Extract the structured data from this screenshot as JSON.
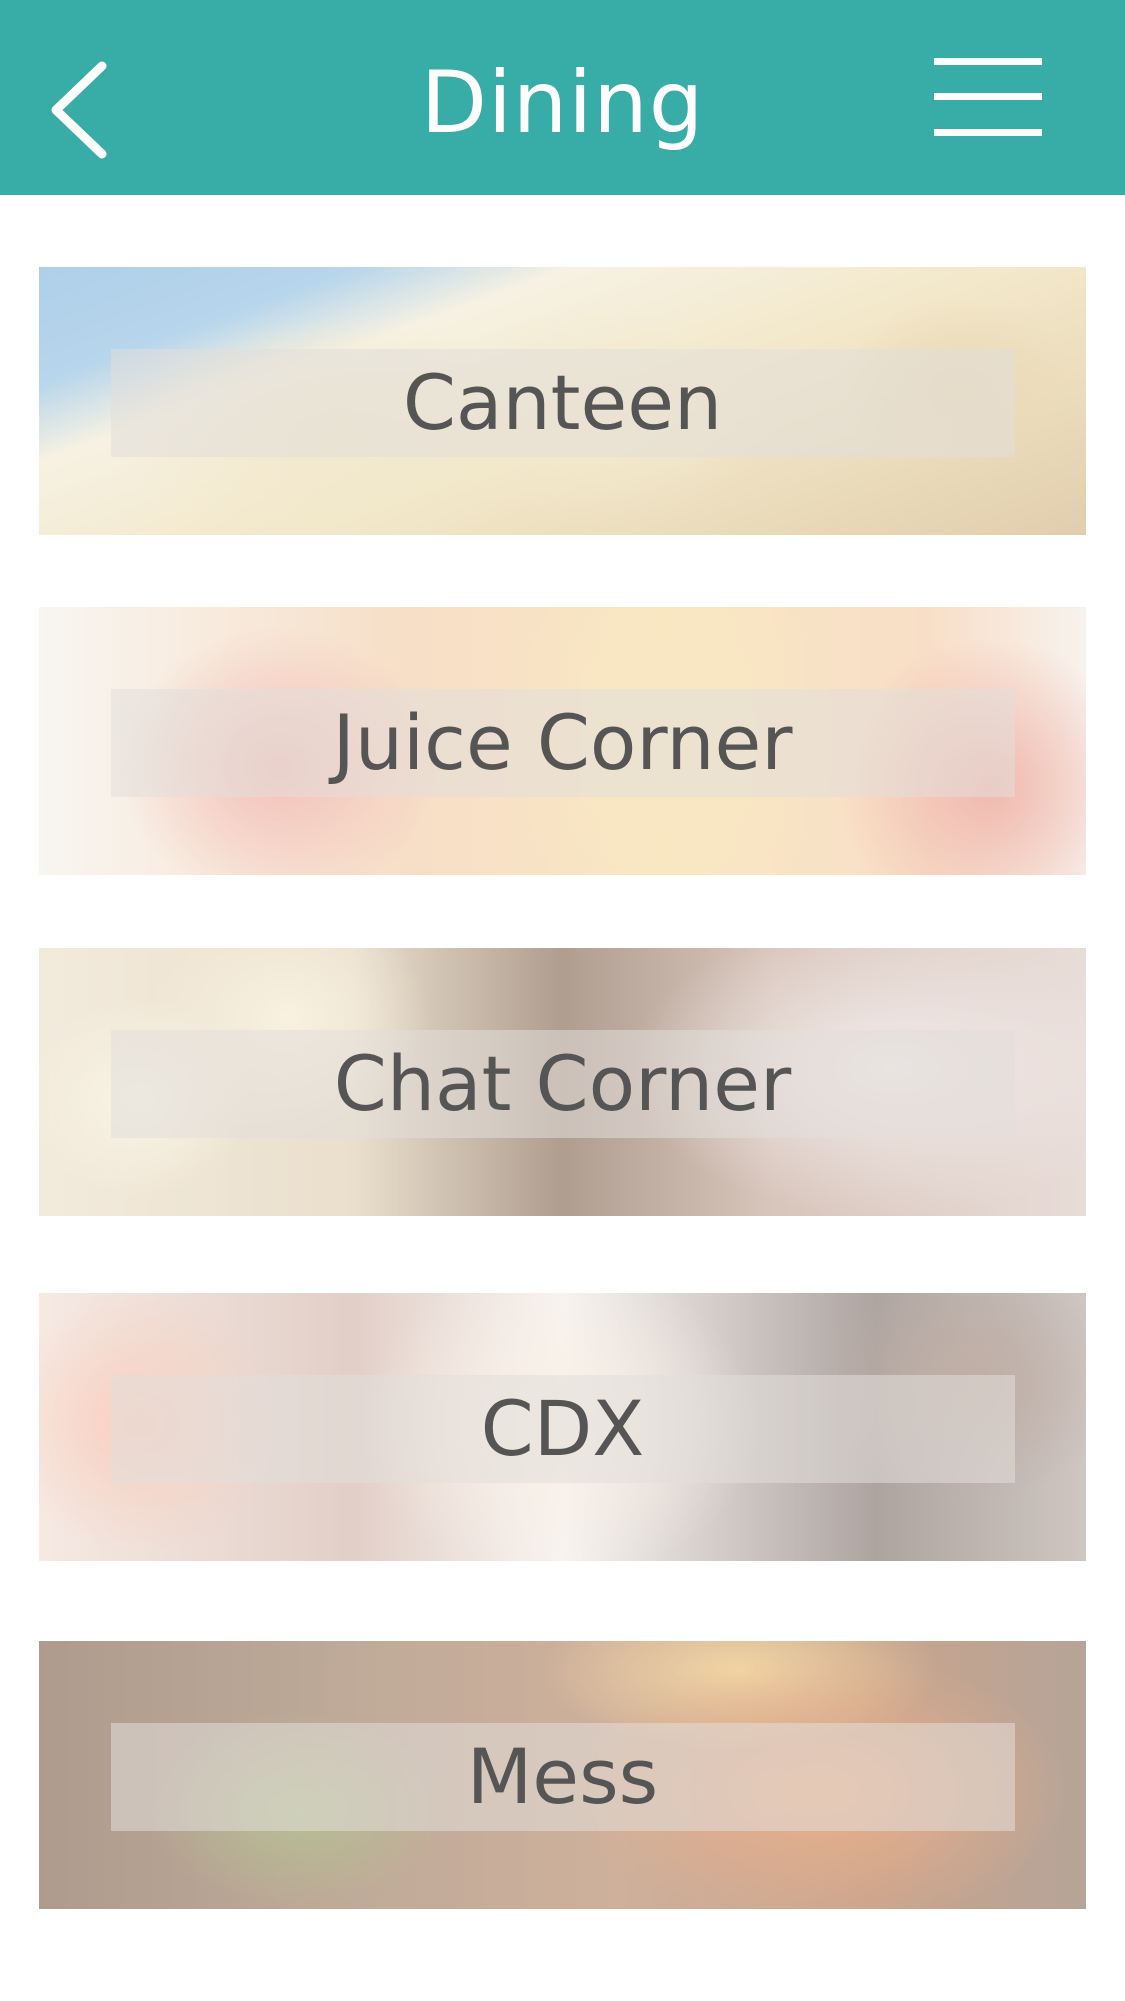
{
  "header": {
    "title": "Dining",
    "back_icon": "chevron-left-icon",
    "menu_icon": "hamburger-menu-icon",
    "background_color": "#38aca6"
  },
  "venues": [
    {
      "label": "Canteen"
    },
    {
      "label": "Juice Corner"
    },
    {
      "label": "Chat Corner"
    },
    {
      "label": "CDX"
    },
    {
      "label": "Mess"
    }
  ]
}
